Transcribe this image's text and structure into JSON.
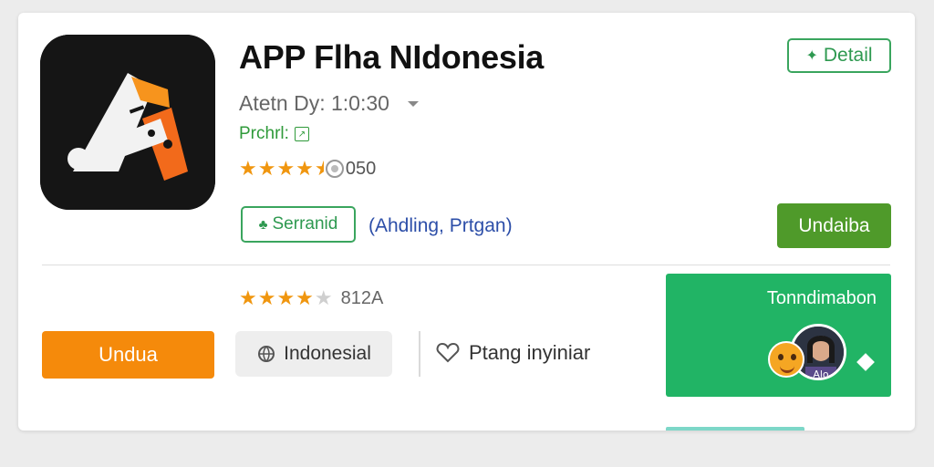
{
  "app": {
    "title": "APP Flha NIdonesia",
    "author": "Atetn Dy: 1:0:30",
    "category": "Prchrl:",
    "rating_count": "050",
    "rating_stars": 4.5
  },
  "actions": {
    "detail_label": "Detail",
    "serrand_label": "Serranid",
    "tags": "(Ahdling, Prtgan)",
    "install_label": "Undaiba",
    "download_label": "Undua"
  },
  "secondary": {
    "rating_stars": 4,
    "rating_text": "812A",
    "language_label": "Indonesial",
    "favorite_label": "Ptang inyiniar"
  },
  "promo": {
    "title": "Tonndimabon",
    "avatar_caption": "Alo"
  },
  "colors": {
    "green_accent": "#3aa55e",
    "install_green": "#4f9a2a",
    "download_orange": "#f58a0b",
    "promo_green": "#21b465",
    "star_orange": "#f0960f",
    "tag_blue": "#2c4ea8"
  },
  "icons": {
    "app_logo": "app-logo-icon",
    "detail": "pin-icon",
    "author_menu": "chevron-down-icon",
    "category_badge": "badge-icon",
    "coin": "coin-icon",
    "serrand": "leaf-icon",
    "language": "globe-icon",
    "favorite": "heart-icon",
    "promo_decor": "diamond-icon"
  }
}
